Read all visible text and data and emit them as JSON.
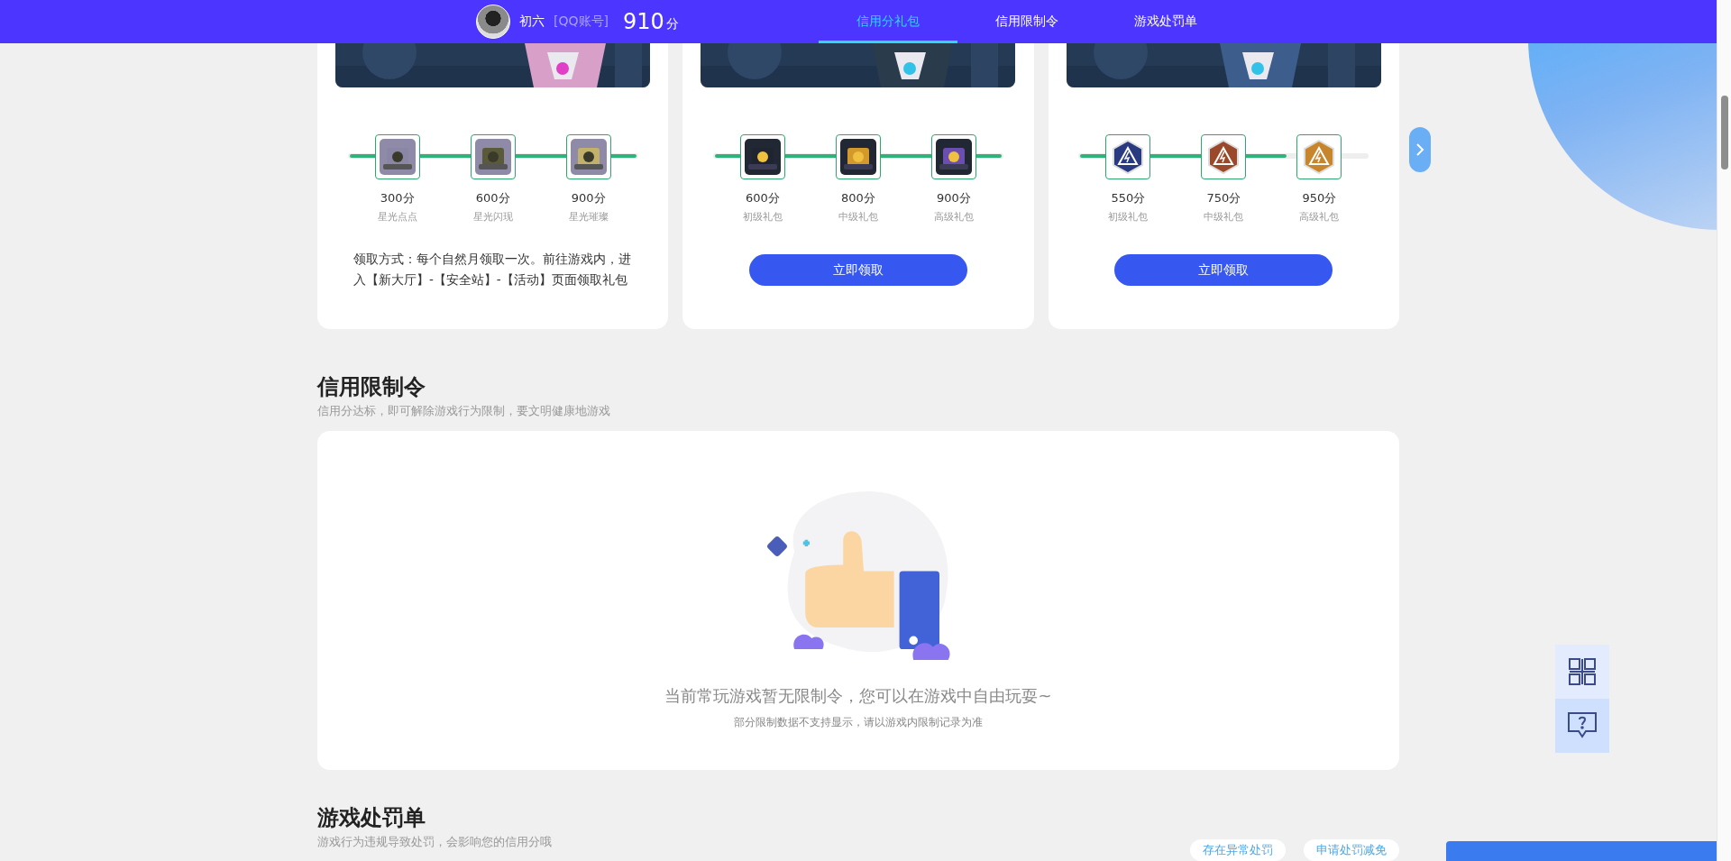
{
  "nav": {
    "user": {
      "name": "初六",
      "account": "[QQ账号]",
      "score": "910",
      "unit": "分"
    },
    "tabs": [
      {
        "label": "信用分礼包",
        "selected": true
      },
      {
        "label": "信用限制令",
        "selected": false
      },
      {
        "label": "游戏处罚单",
        "selected": false
      }
    ]
  },
  "gift_cards": [
    {
      "progress": {
        "level": 1
      },
      "rewards": [
        {
          "score": "300分",
          "name": "星光点点"
        },
        {
          "score": "600分",
          "name": "星光闪现"
        },
        {
          "score": "900分",
          "name": "星光璀璨"
        }
      ],
      "note": "领取方式：每个自然月领取一次。前往游戏内，进入【新大厅】-【安全站】-【活动】页面领取礼包"
    },
    {
      "progress": {
        "level": 1
      },
      "rewards": [
        {
          "score": "600分",
          "name": "初级礼包"
        },
        {
          "score": "800分",
          "name": "中级礼包"
        },
        {
          "score": "900分",
          "name": "高级礼包"
        }
      ],
      "button": "立即领取"
    },
    {
      "progress": {
        "level": 0.72
      },
      "rewards": [
        {
          "score": "550分",
          "name": "初级礼包"
        },
        {
          "score": "750分",
          "name": "中级礼包"
        },
        {
          "score": "950分",
          "name": "高级礼包"
        }
      ],
      "button": "立即领取"
    }
  ],
  "restriction": {
    "title": "信用限制令",
    "subtitle": "信用分达标，即可解除游戏行为限制，要文明健康地游戏",
    "empty_message": "当前常玩游戏暂无限制令，您可以在游戏中自由玩耍~",
    "empty_hint": "部分限制数据不支持显示，请以游戏内限制记录为准"
  },
  "penalty": {
    "title": "游戏处罚单",
    "subtitle": "游戏行为违规导致处罚，会影响您的信用分哦",
    "buttons": [
      "存在异常处罚",
      "申请处罚减免"
    ]
  }
}
